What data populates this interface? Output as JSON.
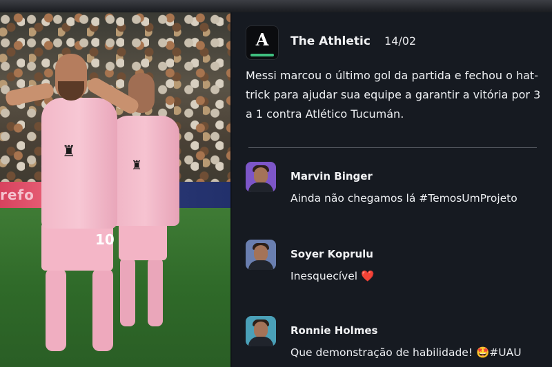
{
  "post": {
    "author": "The Athletic",
    "date": "14/02",
    "logo_letter": "A",
    "text": "Messi marcou o último gol da partida e fechou o hat-trick para ajudar sua equipe a garantir a vitória por 3 a 1 contra Atlético Tucumán."
  },
  "photo": {
    "jersey_number": "10",
    "ad_text": "refo"
  },
  "comments": [
    {
      "name": "Marvin Binger",
      "text": "Ainda não chegamos lá #TemosUmProjeto",
      "avatar_bg": "#7d56c8"
    },
    {
      "name": "Soyer Koprulu",
      "text": "Inesquecível ❤️",
      "avatar_bg": "#6a7fb0"
    },
    {
      "name": "Ronnie Holmes",
      "text": "Que demonstração de habilidade! 🤩#UAU",
      "avatar_bg": "#4aa0b8"
    }
  ],
  "colors": {
    "panel_bg": "#161a21",
    "logo_accent": "#3fbf7f",
    "jersey_pink": "#f4b6c7"
  }
}
